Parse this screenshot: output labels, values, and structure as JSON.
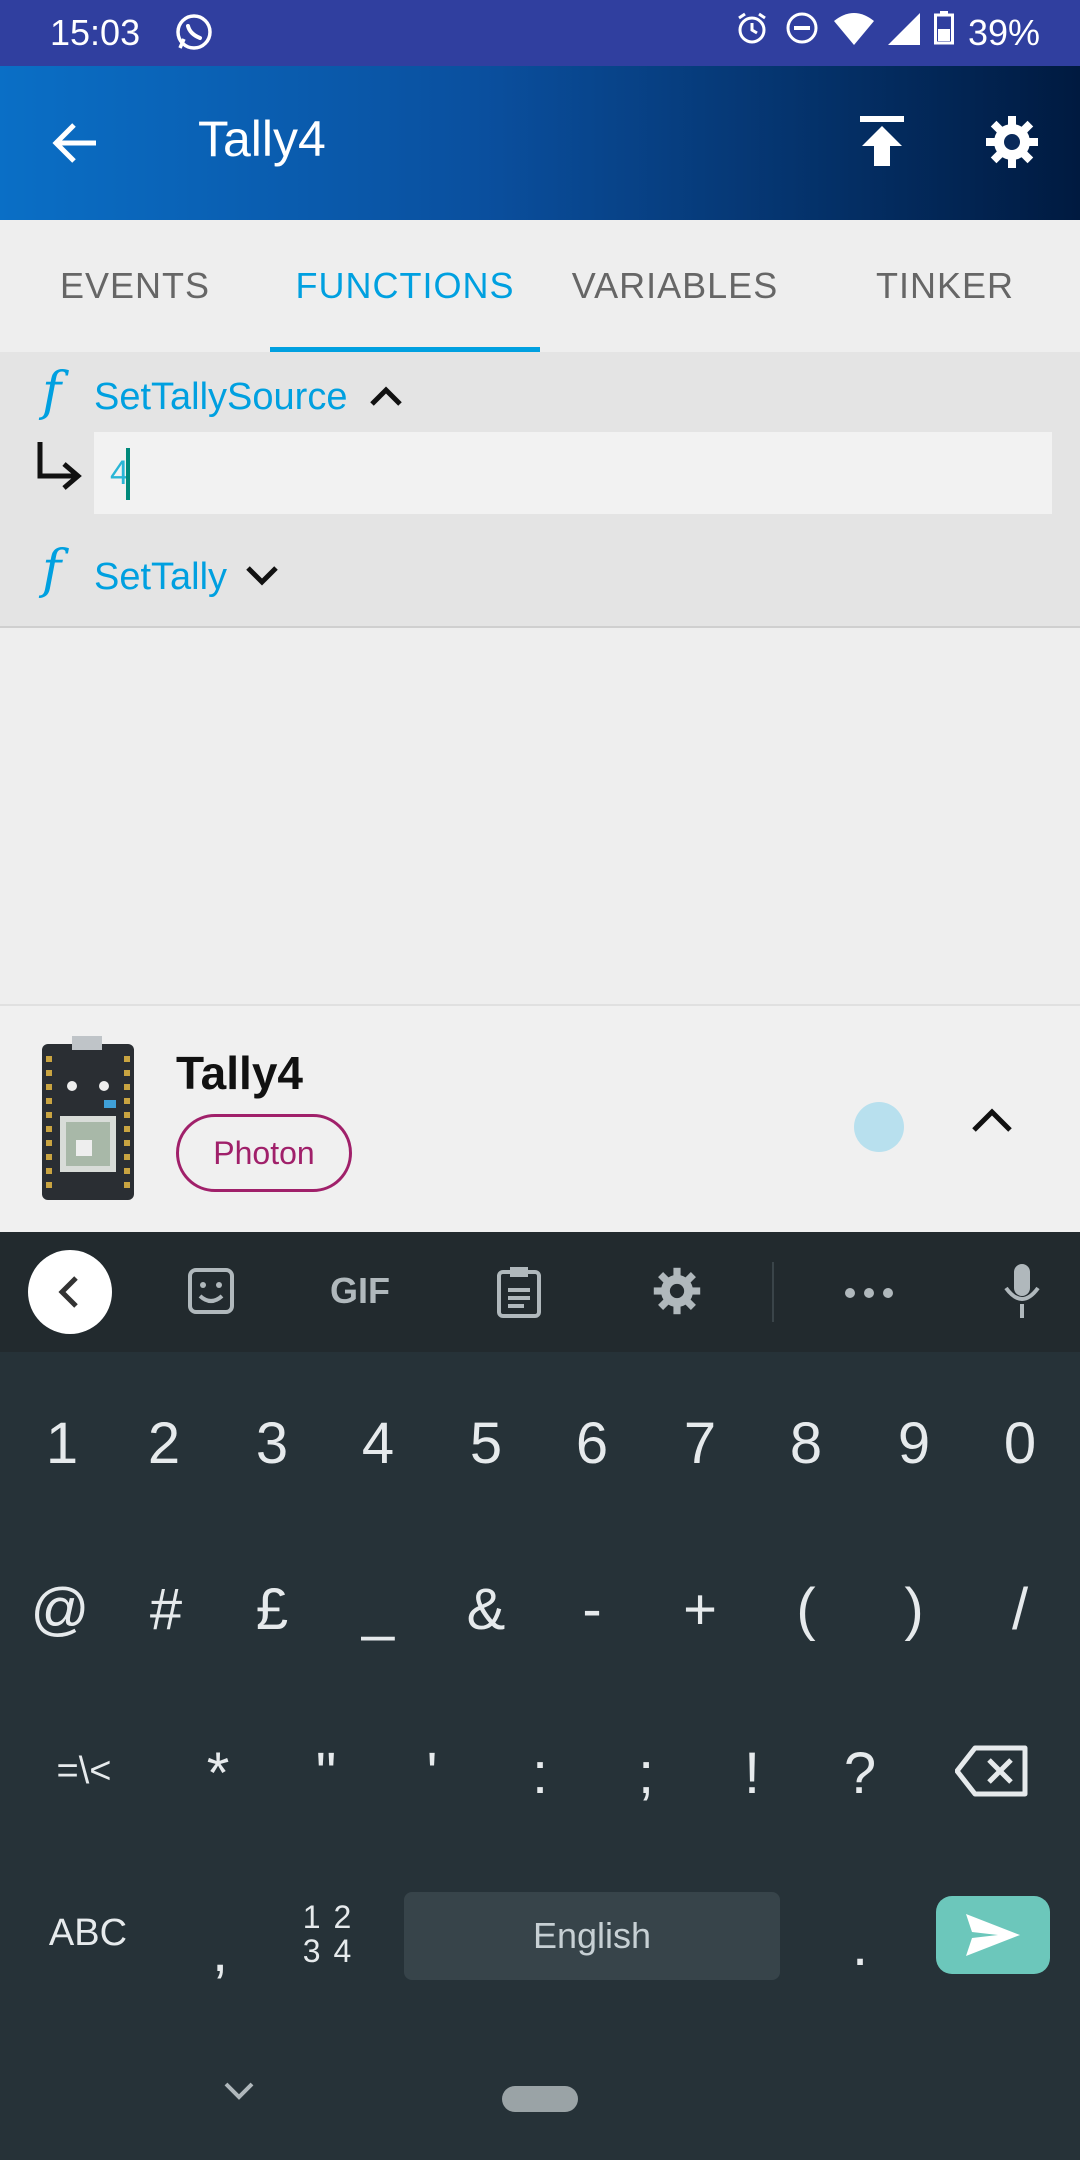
{
  "status_bar": {
    "time": "15:03",
    "battery": "39%"
  },
  "app_bar": {
    "title": "Tally4"
  },
  "tabs": [
    {
      "label": "EVENTS"
    },
    {
      "label": "FUNCTIONS"
    },
    {
      "label": "VARIABLES"
    },
    {
      "label": "TINKER"
    }
  ],
  "functions": [
    {
      "name": "SetTallySource",
      "argument": "4"
    },
    {
      "name": "SetTally"
    }
  ],
  "device": {
    "name": "Tally4",
    "type": "Photon"
  },
  "keyboard": {
    "row1": [
      "1",
      "2",
      "3",
      "4",
      "5",
      "6",
      "7",
      "8",
      "9",
      "0"
    ],
    "row2": [
      "@",
      "#",
      "£",
      "_",
      "&",
      "-",
      "+",
      "(",
      ")",
      "/"
    ],
    "row3": [
      "=\\<",
      "*",
      "\"",
      "'",
      ":",
      ";",
      "!",
      "?"
    ],
    "abc_label": "ABC",
    "comma": ",",
    "numpad_label_top": "1 2",
    "numpad_label_bottom": "3 4",
    "space_label": "English",
    "period": ".",
    "gif_label": "GIF"
  }
}
